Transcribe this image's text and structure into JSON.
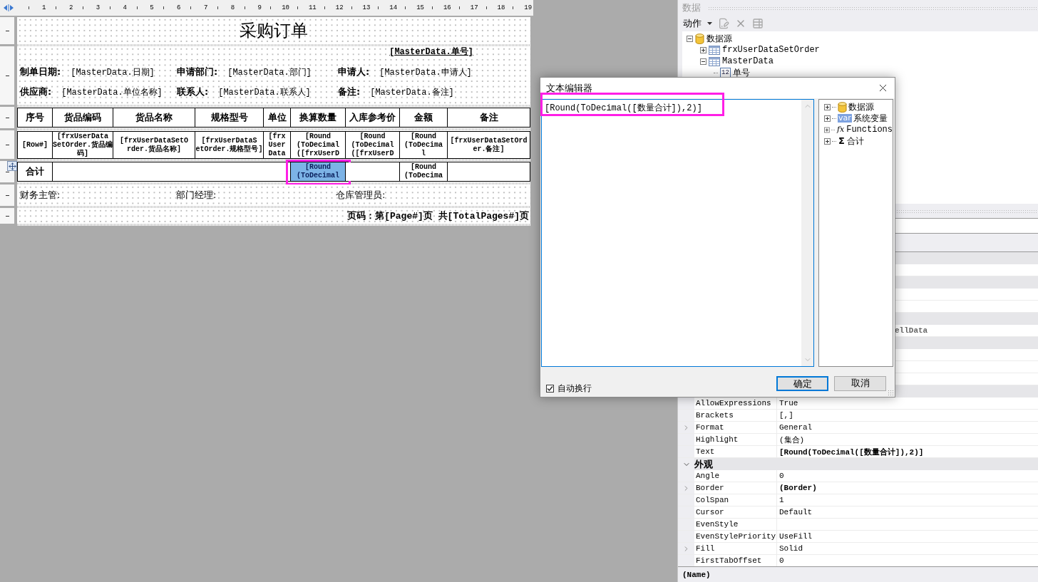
{
  "designer": {
    "ruler_marks": [
      "1",
      "2",
      "3",
      "4",
      "5",
      "6",
      "7",
      "8",
      "9",
      "10",
      "11",
      "12",
      "13",
      "14",
      "15",
      "16",
      "17",
      "18",
      "19"
    ],
    "report": {
      "title": "采购订单",
      "order_no": "[MasterData.单号]",
      "info_rows": [
        [
          {
            "label": "制单日期:",
            "value": "[MasterData.日期]"
          },
          {
            "label": "申请部门:",
            "value": "[MasterData.部门]"
          },
          {
            "label": "申请人:",
            "value": "[MasterData.申请人]"
          }
        ],
        [
          {
            "label": "供应商:",
            "value": "[MasterData.单位名称]"
          },
          {
            "label": "联系人:",
            "value": "[MasterData.联系人]"
          },
          {
            "label": "备注:",
            "value": "[MasterData.备注]"
          }
        ]
      ],
      "table": {
        "columns": [
          "序号",
          "货品编码",
          "货品名称",
          "规格型号",
          "单位",
          "换算数量",
          "入库参考价",
          "金额",
          "备注"
        ],
        "data_row": [
          "[Row#]",
          "[frxUserData\nSetOrder.货品编码]",
          "[frxUserDataSetO\nrder.货品名称]",
          "[frxUserDataS\netOrder.规格型号]",
          "[frx\nUser\nData",
          "[Round\n(ToDecimal\n([frxUserD",
          "[Round\n(ToDecimal\n([frxUserD",
          "[Round\n(ToDecima\nl",
          "[frxUserDataSetOrd\ner.备注]"
        ],
        "summary_row": [
          {
            "text": "合计",
            "selected": false,
            "highlighted": false
          },
          {
            "selected": false,
            "highlighted": false
          },
          {
            "text": "[Round\n(ToDecimal",
            "selected": true,
            "highlighted": true
          },
          {
            "selected": false,
            "highlighted": false
          },
          {
            "text": "[Round\n(ToDecima",
            "selected": false,
            "highlighted": false
          },
          {
            "selected": false,
            "highlighted": false
          }
        ]
      },
      "signatures": [
        "财务主管:",
        "部门经理:",
        "仓库管理员:"
      ],
      "page_number": "页码：第[Page#]页 共[TotalPages#]页"
    }
  },
  "data_panel": {
    "title": "数据",
    "action_label": "动作",
    "tree": [
      {
        "label": "数据源",
        "kind": "database",
        "expanded": true,
        "children": [
          {
            "label": "frxUserDataSetOrder",
            "kind": "table",
            "expanded": false
          },
          {
            "label": "MasterData",
            "kind": "table",
            "expanded": true,
            "children": [
              {
                "label": "单号",
                "kind": "field",
                "icon_text": "12"
              }
            ]
          }
        ]
      }
    ]
  },
  "property_grid": {
    "partial_value": "ellData",
    "rows": [
      {
        "kind": "property",
        "name": "AllowExpressions",
        "value": "True",
        "expandable": false,
        "modified": false
      },
      {
        "kind": "property",
        "name": "Brackets",
        "value": "[,]",
        "expandable": false,
        "modified": false
      },
      {
        "kind": "property",
        "name": "Format",
        "value": "General",
        "expandable": true,
        "modified": false
      },
      {
        "kind": "property",
        "name": "Highlight",
        "value": "(集合)",
        "expandable": false,
        "modified": false
      },
      {
        "kind": "property",
        "name": "Text",
        "value": "[Round(ToDecimal([数量合计]),2)]",
        "expandable": false,
        "modified": true
      },
      {
        "kind": "category",
        "name": "外观",
        "expanded": true
      },
      {
        "kind": "property",
        "name": "Angle",
        "value": "0",
        "expandable": false,
        "modified": false
      },
      {
        "kind": "property",
        "name": "Border",
        "value": "(Border)",
        "expandable": true,
        "modified": true
      },
      {
        "kind": "property",
        "name": "ColSpan",
        "value": "1",
        "expandable": false,
        "modified": false
      },
      {
        "kind": "property",
        "name": "Cursor",
        "value": "Default",
        "expandable": false,
        "modified": false
      },
      {
        "kind": "property",
        "name": "EvenStyle",
        "expandable": false
      },
      {
        "kind": "property",
        "name": "EvenStylePriority",
        "value": "UseFill",
        "expandable": false,
        "modified": false
      },
      {
        "kind": "property",
        "name": "Fill",
        "value": "Solid",
        "expandable": true,
        "modified": false
      },
      {
        "kind": "property",
        "name": "FirstTabOffset",
        "value": "0",
        "expandable": false,
        "modified": false
      }
    ],
    "description": "(Name)"
  },
  "dialog": {
    "title": "文本编辑器",
    "text": "[Round(ToDecimal([数量合计]),2)]",
    "highlighted": true,
    "tree": [
      {
        "label": "数据源",
        "kind": "database",
        "expanded": false
      },
      {
        "label": "系统变量",
        "kind": "var",
        "icon_text": "var",
        "expanded": false
      },
      {
        "label": "Functions",
        "kind": "fx",
        "icon_text": "fx",
        "expanded": false
      },
      {
        "label": "合计",
        "kind": "sigma",
        "icon_text": "Σ",
        "expanded": false
      }
    ],
    "word_wrap": {
      "label": "自动换行",
      "checked": true
    },
    "buttons": [
      {
        "label": "确定",
        "default": true
      },
      {
        "label": "取消",
        "default": false
      }
    ]
  }
}
